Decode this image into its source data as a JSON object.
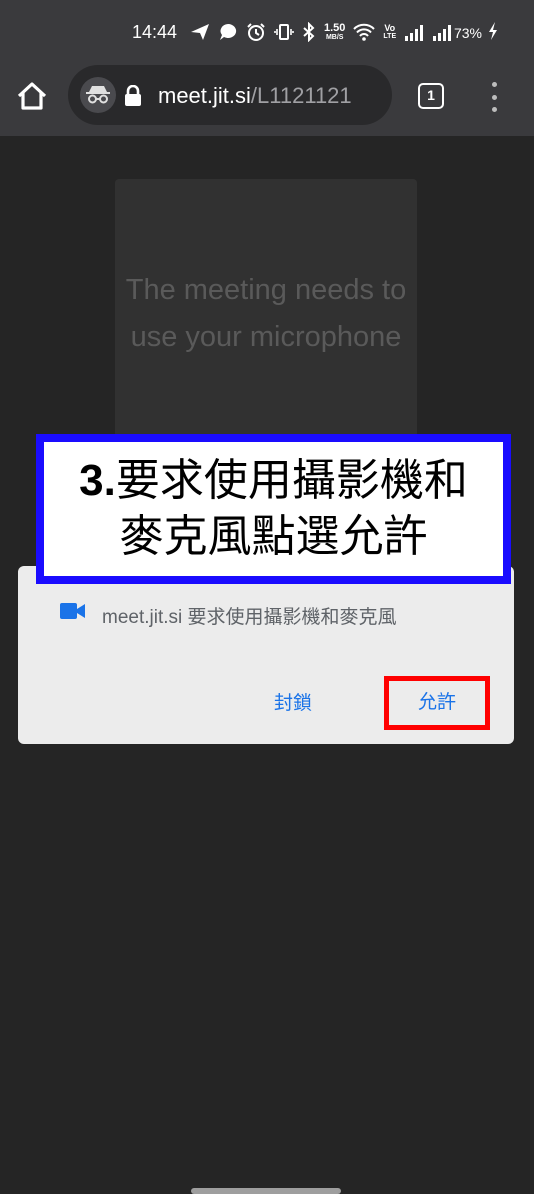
{
  "status_bar": {
    "time": "14:44",
    "net_speed_value": "1.50",
    "net_speed_unit": "MB/S",
    "volte_label_top": "Vo",
    "volte_label_bottom": "LTE",
    "battery_percent": "73%",
    "icons": [
      "send-icon",
      "chat-bubble-icon",
      "alarm-icon",
      "vibrate-icon",
      "bluetooth-icon",
      "wifi-icon",
      "signal-icon",
      "signal-icon",
      "charging-bolt-icon"
    ]
  },
  "browser": {
    "url_host": "meet.jit.si",
    "url_path": "/L1121121",
    "tab_count": "1",
    "icons": [
      "home-icon",
      "incognito-icon",
      "lock-icon",
      "overflow-menu-icon"
    ]
  },
  "page": {
    "prompt_text": "The meeting needs to use your microphone"
  },
  "annotation": {
    "number": "3.",
    "line1": "要求使用攝影機和",
    "line2": "麥克風點選允許",
    "border_color": "#1a0cff"
  },
  "permission_dialog": {
    "message": "meet.jit.si 要求使用攝影機和麥克風",
    "block_label": "封鎖",
    "allow_label": "允許",
    "icon": "video-camera-icon",
    "accent_color": "#1a73e8",
    "highlight_color": "#ff0000"
  }
}
